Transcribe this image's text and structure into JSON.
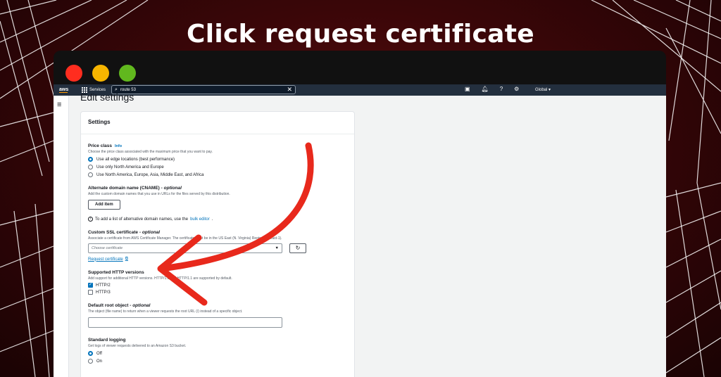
{
  "headline": "Click request certificate",
  "topnav": {
    "logo": "aws",
    "services": "Services",
    "search_value": "route 53",
    "region": "Global"
  },
  "page": {
    "title": "Edit settings"
  },
  "settings": {
    "header": "Settings",
    "price_class": {
      "label": "Price class",
      "info": "Info",
      "desc": "Choose the price class associated with the maximum price that you want to pay.",
      "options": [
        "Use all edge locations (best performance)",
        "Use only North America and Europe",
        "Use North America, Europe, Asia, Middle East, and Africa"
      ],
      "selected": 0
    },
    "cname": {
      "label": "Alternate domain name (CNAME)",
      "optional": "optional",
      "desc": "Add the custom domain names that you use in URLs for the files served by this distribution.",
      "add_item": "Add item",
      "note_prefix": "To add a list of alternative domain names, use the",
      "note_link": "bulk editor",
      "note_suffix": "."
    },
    "ssl": {
      "label": "Custom SSL certificate",
      "optional": "optional",
      "desc": "Associate a certificate from AWS Certificate Manager. The certificate must be in the US East (N. Virginia) Region (us-east-1).",
      "placeholder": "Choose certificate",
      "request_link": "Request certificate"
    },
    "http_versions": {
      "label": "Supported HTTP versions",
      "desc": "Add support for additional HTTP versions. HTTP/1.0 and HTTP/1.1 are supported by default.",
      "options": [
        "HTTP/2",
        "HTTP/3"
      ],
      "checked": [
        true,
        false
      ]
    },
    "root_object": {
      "label": "Default root object",
      "optional": "optional",
      "desc": "The object (file name) to return when a viewer requests the root URL (/) instead of a specific object."
    },
    "logging": {
      "label": "Standard logging",
      "desc": "Get logs of viewer requests delivered to an Amazon S3 bucket.",
      "options": [
        "Off",
        "On"
      ],
      "selected": 0
    }
  },
  "colors": {
    "arrow": "#e8291c",
    "accent": "#0073bb",
    "nav": "#232f3e"
  }
}
